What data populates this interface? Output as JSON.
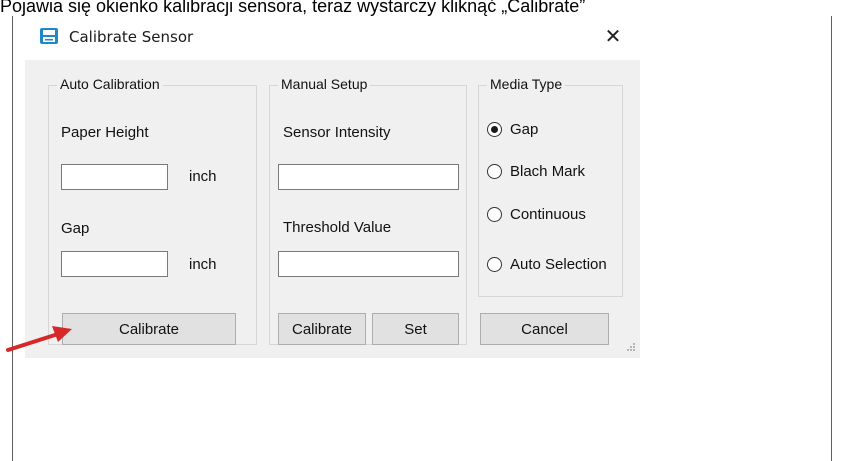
{
  "caption": {
    "text": "Pojawia się okienko kalibracji sensora, teraz wystarczy kliknąć „Calibrate”"
  },
  "dialog": {
    "title": "Calibrate Sensor",
    "close_glyph": "✕",
    "auto_calibration": {
      "legend": "Auto Calibration",
      "paper_height_label": "Paper Height",
      "paper_height_value": "",
      "paper_height_unit": "inch",
      "gap_label": "Gap",
      "gap_value": "",
      "gap_unit": "inch",
      "calibrate_label": "Calibrate"
    },
    "manual_setup": {
      "legend": "Manual Setup",
      "sensor_intensity_label": "Sensor Intensity",
      "sensor_intensity_value": "",
      "threshold_label": "Threshold Value",
      "threshold_value": "",
      "calibrate_label": "Calibrate",
      "set_label": "Set"
    },
    "media_type": {
      "legend": "Media Type",
      "options": [
        {
          "label": "Gap",
          "checked": true
        },
        {
          "label": "Blach Mark",
          "checked": false
        },
        {
          "label": "Continuous",
          "checked": false
        },
        {
          "label": "Auto Selection",
          "checked": false
        }
      ],
      "cancel_label": "Cancel"
    }
  },
  "icons": {
    "title_icon": "printer-icon",
    "annotation": "red-arrow-icon"
  },
  "colors": {
    "client_bg": "#f0f0f0",
    "title_icon": "#1e88c8",
    "arrow": "#d62828"
  }
}
